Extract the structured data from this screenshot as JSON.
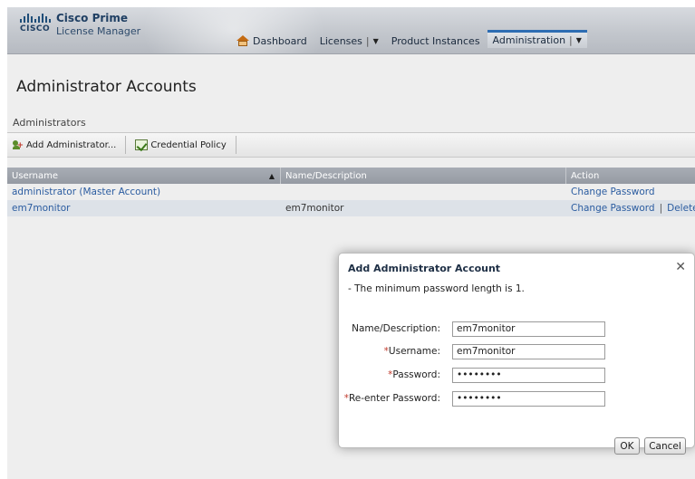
{
  "header": {
    "brand_word": "CISCO",
    "app_title": "Cisco Prime",
    "app_subtitle": "License Manager",
    "nav": [
      {
        "label": "Dashboard"
      },
      {
        "label": "Licenses"
      },
      {
        "label": "Product Instances"
      },
      {
        "label": "Administration"
      }
    ],
    "separator": "|",
    "dropdown_glyph": "▼"
  },
  "page": {
    "title": "Administrator Accounts",
    "section": "Administrators"
  },
  "toolbar": {
    "add_admin_label": "Add Administrator...",
    "credential_policy_label": "Credential Policy"
  },
  "table": {
    "columns": {
      "username": "Username",
      "name": "Name/Description",
      "action": "Action"
    },
    "sort_glyph": "▲",
    "rows": [
      {
        "username": "administrator (Master Account)",
        "name": "",
        "change_password": "Change Password",
        "delete": ""
      },
      {
        "username": "em7monitor",
        "name": "em7monitor",
        "change_password": "Change Password",
        "delete": "Delete"
      }
    ],
    "action_separator": "|"
  },
  "modal": {
    "title": "Add Administrator Account",
    "close_glyph": "✕",
    "note": "- The minimum password length is 1.",
    "required_mark": "*",
    "fields": {
      "name": {
        "label": "Name/Description:",
        "value": "em7monitor"
      },
      "username": {
        "label": "Username:",
        "value": "em7monitor"
      },
      "password": {
        "label": "Password:",
        "value": "••••••••"
      },
      "reenter": {
        "label": "Re-enter Password:",
        "value": "••••••••"
      }
    },
    "ok_label": "OK",
    "cancel_label": "Cancel"
  },
  "colors": {
    "link": "#2b5ca0",
    "header_bg": "#c3c7cd",
    "required": "#c0392b",
    "table_header": "#a3a8b0"
  }
}
